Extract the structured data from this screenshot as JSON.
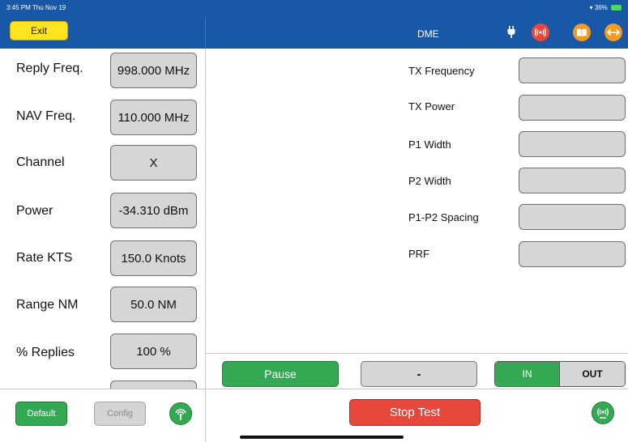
{
  "status_bar": {
    "time": "3:45 PM  Thu Nov 19",
    "battery": "36%"
  },
  "header": {
    "exit_label": "Exit",
    "title": "DME"
  },
  "icons": {
    "plug": "plug-icon",
    "signal": "broadcast-signal-icon",
    "book": "book-icon",
    "arrows": "left-right-arrows-icon",
    "antenna": "antenna-icon",
    "tower": "radio-tower-icon"
  },
  "left": {
    "rows": [
      {
        "label": "Reply Freq.",
        "value": "998.000 MHz"
      },
      {
        "label": "NAV Freq.",
        "value": "110.000 MHz"
      },
      {
        "label": "Channel",
        "value": "X"
      },
      {
        "label": "Power",
        "value": "-34.310 dBm"
      },
      {
        "label": "Rate KTS",
        "value": "150.0 Knots"
      },
      {
        "label": "Range NM",
        "value": "50.0 NM"
      },
      {
        "label": "% Replies",
        "value": "100 %"
      },
      {
        "label": "",
        "value": ""
      }
    ],
    "default_label": "Default",
    "config_label": "Config"
  },
  "right": {
    "rows": [
      {
        "label": "TX Frequency",
        "value": ""
      },
      {
        "label": "TX Power",
        "value": ""
      },
      {
        "label": "P1 Width",
        "value": ""
      },
      {
        "label": "P2 Width",
        "value": ""
      },
      {
        "label": "P1-P2 Spacing",
        "value": ""
      },
      {
        "label": "PRF",
        "value": ""
      }
    ]
  },
  "controls": {
    "pause_label": "Pause",
    "dash_label": "-",
    "in_label": "IN",
    "out_label": "OUT",
    "stop_label": "Stop Test"
  },
  "colors": {
    "header_blue": "#1858a6",
    "exit_yellow": "#ffe51f",
    "green": "#34a853",
    "red": "#e8473c",
    "orange": "#f39a21",
    "field_gray": "#d6d6d6"
  }
}
